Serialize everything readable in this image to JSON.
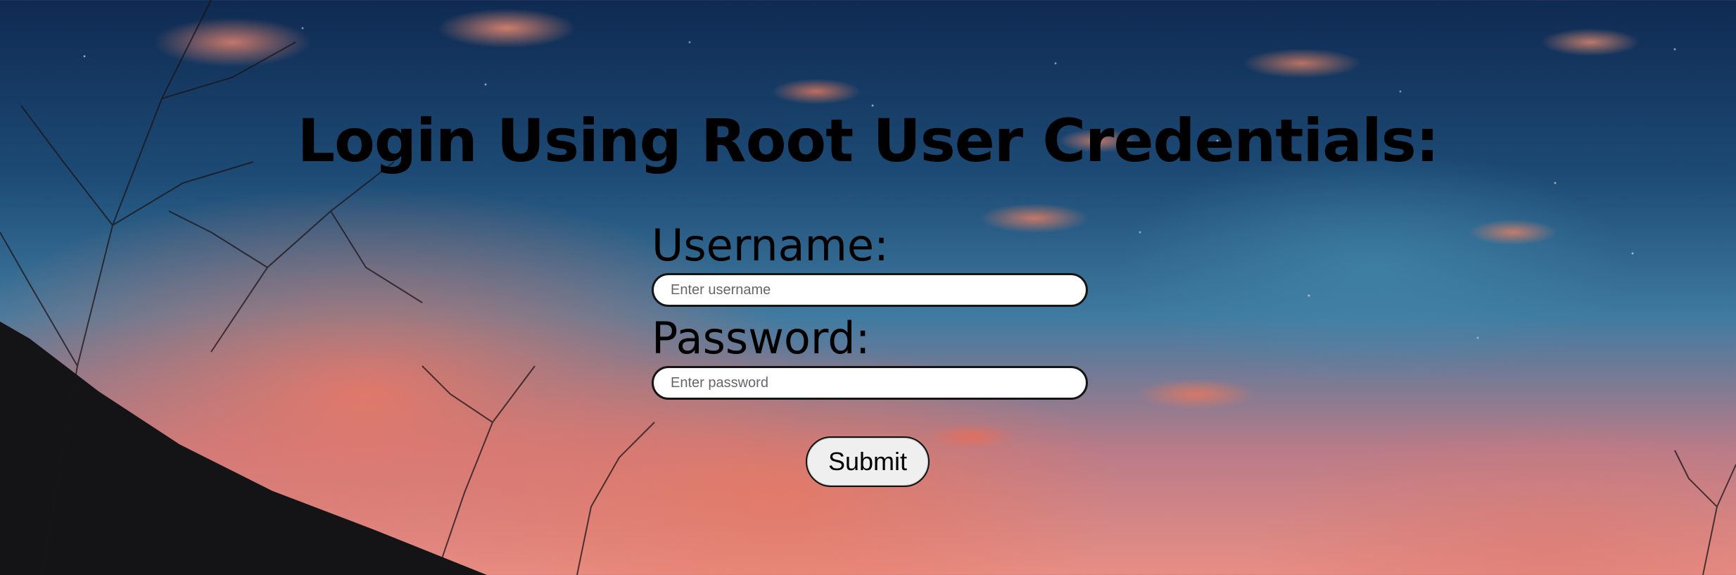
{
  "page": {
    "title": "Login Using Root User Credentials:"
  },
  "form": {
    "username": {
      "label": "Username:",
      "placeholder": "Enter username",
      "value": ""
    },
    "password": {
      "label": "Password:",
      "placeholder": "Enter password",
      "value": ""
    },
    "submit_label": "Submit"
  },
  "background": {
    "scene": "sunset-sky-with-stars",
    "colors": {
      "sky_top": "#0f2a52",
      "sky_mid": "#3f7aa0",
      "glow": "#e88e84",
      "hill": "#141417"
    }
  }
}
